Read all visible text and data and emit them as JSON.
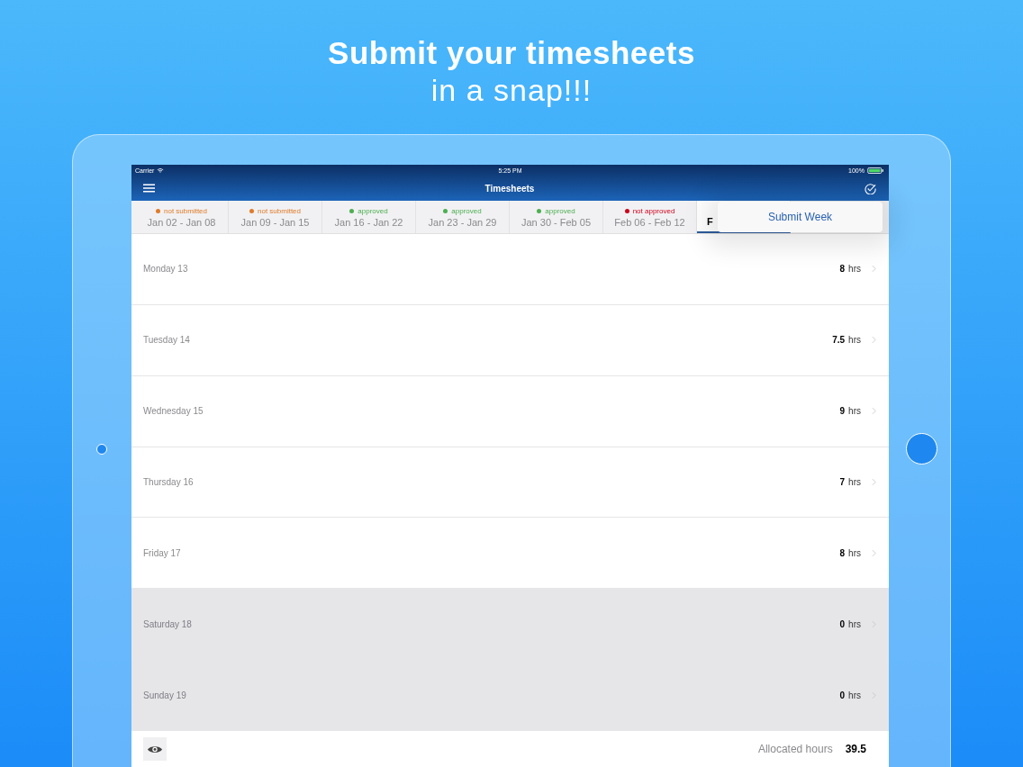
{
  "headline": {
    "title": "Submit your timesheets",
    "subtitle": "in a snap!!!"
  },
  "status_bar": {
    "carrier": "Carrier",
    "time": "5:25 PM",
    "battery": "100%"
  },
  "nav_bar": {
    "title": "Timesheets"
  },
  "weeks": [
    {
      "status": "not submitted",
      "color": "#e07b2a",
      "range": "Jan 02 - Jan 08",
      "selected": false
    },
    {
      "status": "not submitted",
      "color": "#e07b2a",
      "range": "Jan 09 - Jan 15",
      "selected": false
    },
    {
      "status": "approved",
      "color": "#4caf50",
      "range": "Jan 16 - Jan 22",
      "selected": false
    },
    {
      "status": "approved",
      "color": "#4caf50",
      "range": "Jan 23 - Jan 29",
      "selected": false
    },
    {
      "status": "approved",
      "color": "#4caf50",
      "range": "Jan 30 - Feb 05",
      "selected": false
    },
    {
      "status": "not approved",
      "color": "#d0021b",
      "range": "Feb 06 - Feb 12",
      "selected": false
    },
    {
      "range": "F",
      "selected": true
    }
  ],
  "popover": {
    "label": "Submit Week"
  },
  "days": [
    {
      "label": "Monday 13",
      "hours": "8",
      "unit": "hrs",
      "weekend": false
    },
    {
      "label": "Tuesday 14",
      "hours": "7.5",
      "unit": "hrs",
      "weekend": false
    },
    {
      "label": "Wednesday 15",
      "hours": "9",
      "unit": "hrs",
      "weekend": false
    },
    {
      "label": "Thursday 16",
      "hours": "7",
      "unit": "hrs",
      "weekend": false
    },
    {
      "label": "Friday 17",
      "hours": "8",
      "unit": "hrs",
      "weekend": false
    },
    {
      "label": "Saturday 18",
      "hours": "0",
      "unit": "hrs",
      "weekend": true
    },
    {
      "label": "Sunday 19",
      "hours": "0",
      "unit": "hrs",
      "weekend": true
    }
  ],
  "footer": {
    "label": "Allocated hours",
    "total": "39.5"
  }
}
